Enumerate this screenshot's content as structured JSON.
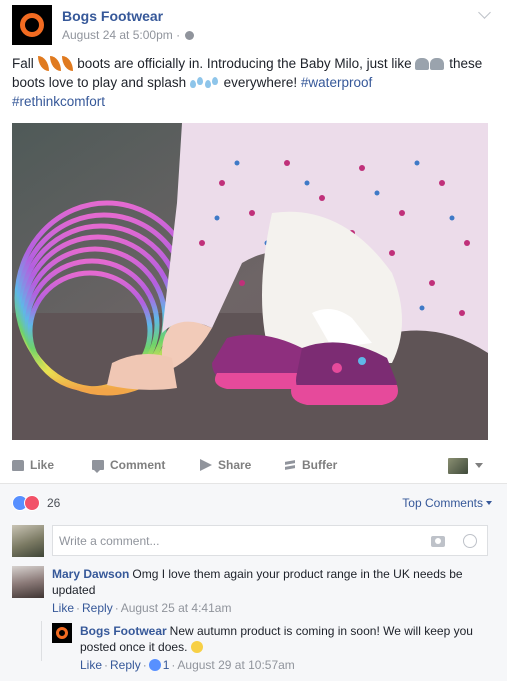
{
  "post": {
    "page_name": "Bogs Footwear",
    "date": "August 24 at 5:00pm",
    "meta_sep": "·",
    "text_parts": {
      "t1": "Fall ",
      "t2": " boots are officially in. Introducing the Baby Milo, just like ",
      "t3": " these boots love to play and splash ",
      "t4": " everywhere! ",
      "hashtag1": "#waterproof",
      "hashtag2": "#rethinkcomfort"
    },
    "icons": {
      "leaf": "fallen-leaf-icon",
      "elephant": "elephant-icon",
      "drops": "sweat-droplets-icon"
    }
  },
  "actions": {
    "like": "Like",
    "comment": "Comment",
    "share": "Share",
    "buffer": "Buffer"
  },
  "reactions": {
    "count": "26",
    "sort_label": "Top Comments"
  },
  "write_comment": {
    "placeholder": "Write a comment..."
  },
  "comments": [
    {
      "name": "Mary Dawson",
      "text": "Omg I love them again your product range in the UK needs be updated",
      "like": "Like",
      "reply": "Reply",
      "time": "August 25 at 4:41am"
    },
    {
      "name": "Bogs Footwear",
      "text": "New autumn product is coming in soon! We will keep you posted once it does.",
      "like": "Like",
      "reply": "Reply",
      "likes": "1",
      "time": "August 29 at 10:57am"
    }
  ],
  "colors": {
    "link": "#365899",
    "brand_orange": "#f26b21",
    "muted": "#90949c",
    "comment_bg": "#f6f7f9"
  }
}
